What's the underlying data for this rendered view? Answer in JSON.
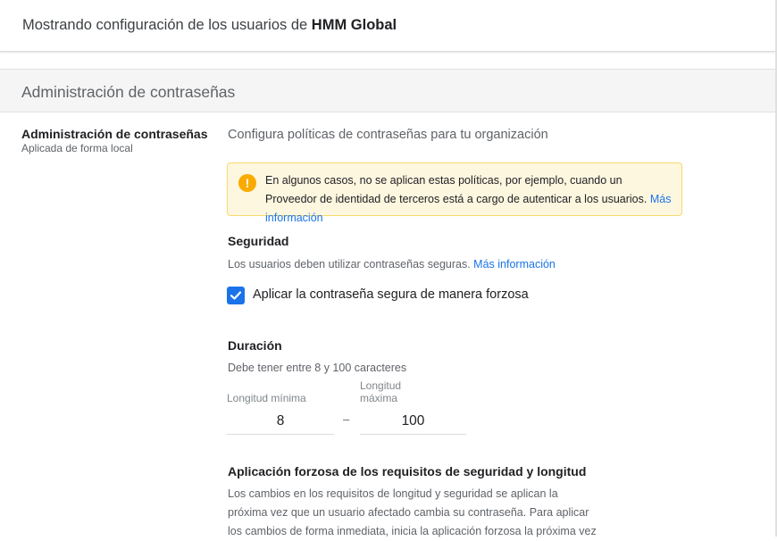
{
  "header": {
    "title_prefix": "Mostrando configuración de los usuarios de",
    "org_name": "HMM Global"
  },
  "section": {
    "title": "Administración de contraseñas"
  },
  "setting": {
    "name": "Administración de contraseñas",
    "scope": "Aplicada de forma local",
    "intro": "Configura políticas de contraseñas para tu organización"
  },
  "notice": {
    "text": "En algunos casos, no se aplican estas políticas, por ejemplo, cuando un Proveedor de identidad de terceros está a cargo de autenticar a los usuarios.",
    "link": "Más información",
    "icon": "warning-icon"
  },
  "security": {
    "title": "Seguridad",
    "description": "Los usuarios deben utilizar contraseñas seguras.",
    "link": "Más información",
    "checkbox_label": "Aplicar la contraseña segura de manera forzosa",
    "checked": true
  },
  "duration": {
    "title": "Duración",
    "description": "Debe tener entre 8 y 100 caracteres",
    "min_label": "Longitud mínima",
    "min_value": "8",
    "separator": "–",
    "max_label_line1": "Longitud",
    "max_label_line2": "máxima",
    "max_value": "100"
  },
  "enforcement": {
    "title": "Aplicación forzosa de los requisitos de seguridad y longitud",
    "line1": "Los cambios en los requisitos de longitud y seguridad se aplican la",
    "line2": "próxima vez que un usuario afectado cambia su contraseña. Para aplicar",
    "line3": "los cambios de forma inmediata, inicia la aplicación forzosa la próxima vez"
  },
  "colors": {
    "accent": "#1a73e8",
    "warning": "#f9ab00",
    "notice_bg": "#fef7e0"
  }
}
